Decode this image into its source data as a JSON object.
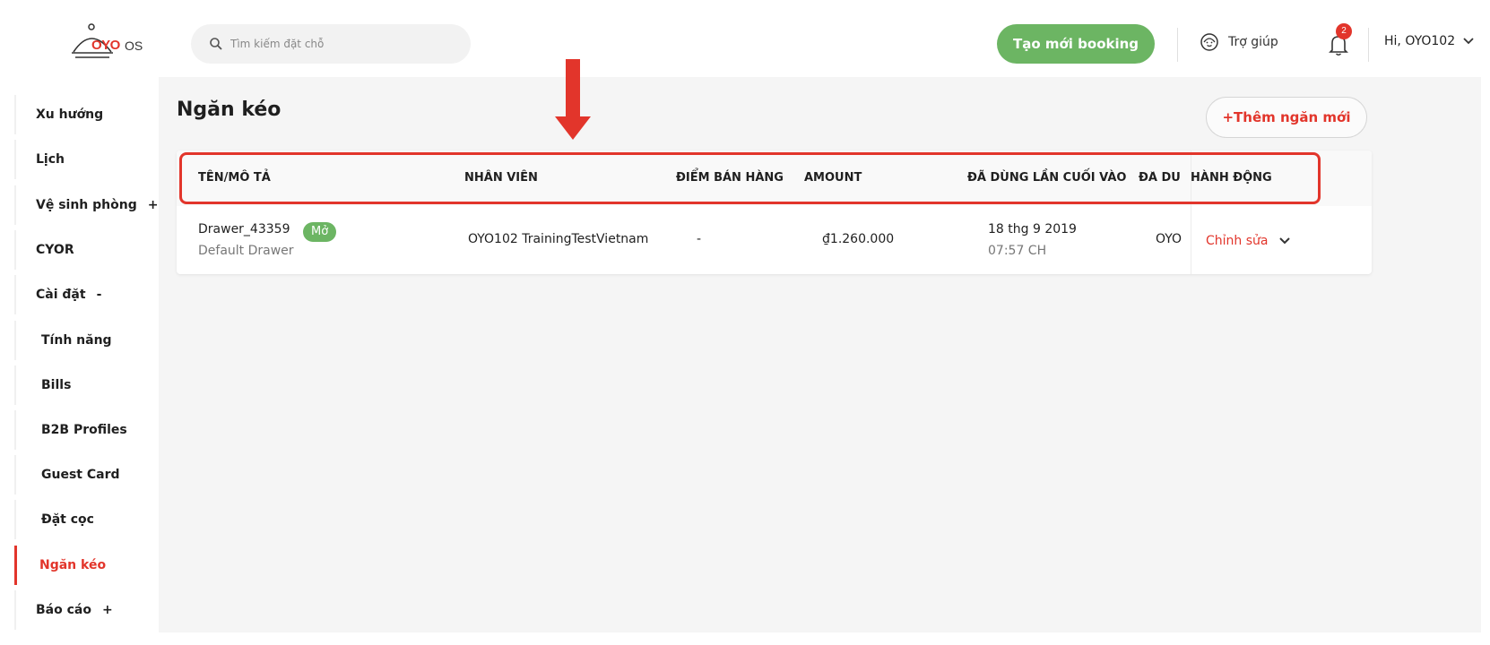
{
  "header": {
    "logo_text": "OYO",
    "logo_suffix": "OS",
    "search_placeholder": "Tìm kiếm đặt chỗ",
    "create_booking_label": "Tạo mới booking",
    "help_label": "Trợ giúp",
    "notification_count": "2",
    "user_greeting": "Hi, OYO102"
  },
  "sidebar": {
    "items": [
      {
        "label": "Xu hướng",
        "toggle": ""
      },
      {
        "label": "Lịch",
        "toggle": ""
      },
      {
        "label": "Vệ sinh phòng",
        "toggle": "+"
      },
      {
        "label": "CYOR",
        "toggle": ""
      },
      {
        "label": "Cài đặt",
        "toggle": "-"
      },
      {
        "label": "Tính năng",
        "toggle": ""
      },
      {
        "label": "Bills",
        "toggle": ""
      },
      {
        "label": "B2B Profiles",
        "toggle": ""
      },
      {
        "label": "Guest Card",
        "toggle": ""
      },
      {
        "label": "Đặt cọc",
        "toggle": ""
      },
      {
        "label": "Ngăn kéo",
        "toggle": ""
      },
      {
        "label": "Báo cáo",
        "toggle": "+"
      }
    ],
    "active_index": 10
  },
  "main": {
    "title": "Ngăn kéo",
    "add_button_label": "+Thêm ngăn mới",
    "table": {
      "headers": {
        "name": "TÊN/MÔ TẢ",
        "staff": "NHÂN VIÊN",
        "pos": "ĐIỂM BÁN HÀNG",
        "amount": "AMOUNT",
        "last_used": "ĐÃ DÙNG LẦN CUỐI VÀO",
        "used_by": "ĐÃ DÙ",
        "action": "HÀNH ĐỘNG"
      },
      "rows": [
        {
          "name": "Drawer_43359",
          "status": "Mở",
          "description": "Default Drawer",
          "staff": "OYO102 TrainingTestVietnam",
          "pos": "-",
          "amount": "₫1.260.000",
          "last_used_date": "18 thg 9 2019",
          "last_used_time": "07:57 CH",
          "used_by": "OYO",
          "action": "Chỉnh sửa"
        }
      ]
    }
  },
  "colors": {
    "brand_red": "#e2352b",
    "brand_green": "#6cb563",
    "main_bg": "#f5f5f5"
  }
}
